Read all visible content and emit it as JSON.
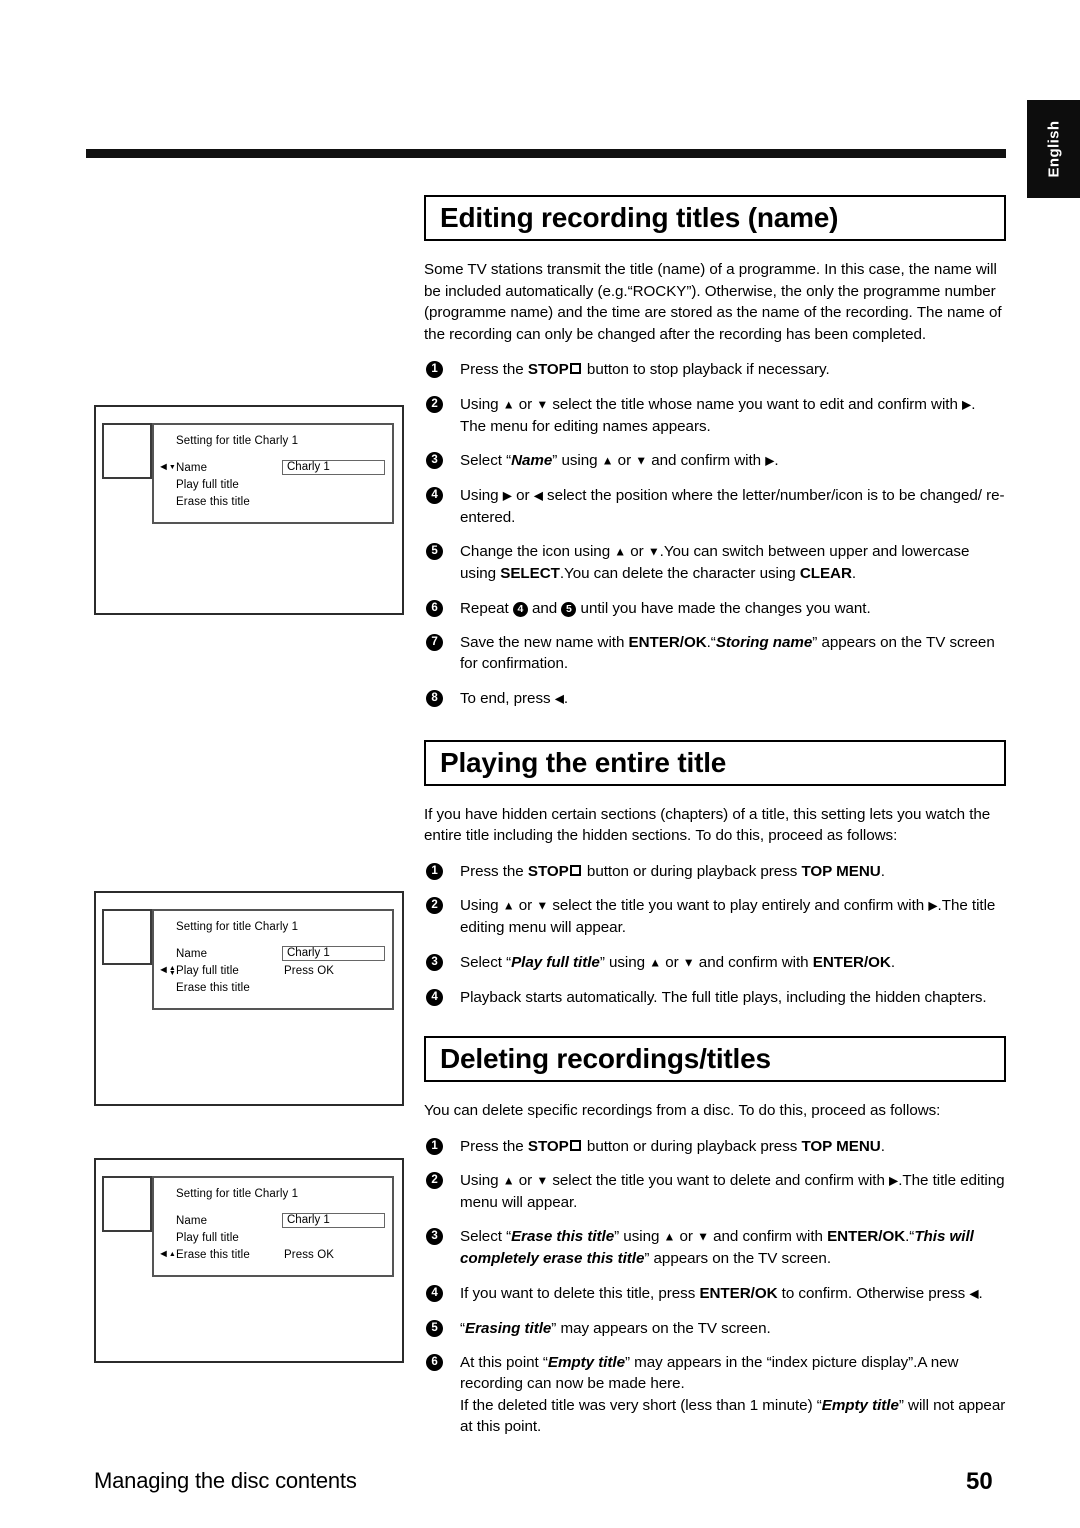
{
  "language_tab": {
    "label": "English"
  },
  "footer": {
    "section": "Managing the disc contents",
    "page": "50"
  },
  "sections": [
    {
      "id": "editing-recording-titles",
      "heading": "Editing recording titles (name)",
      "intro": "Some TV stations transmit the title (name) of a programme. In this case, the name will be included automatically (e.g. “ROCKY”). Otherwise, the only the programme number (programme name) and the time are stored as the name of the recording. The name of the recording can only be changed after the recording has been completed.",
      "steps": [
        {
          "num": "1",
          "text": "Press the STOP □ button to stop playback if necessary."
        },
        {
          "num": "2",
          "text": "Using ▲ or ▼ select the title whose name you want to edit and confirm with ▶. The menu for editing names appears."
        },
        {
          "num": "3",
          "text": "Select “Name” using ▲ or ▼ and confirm with ▶."
        },
        {
          "num": "4",
          "text": "Using ▶ or ◀ select the position where the letter/number/icon is to be changed/ re-entered."
        },
        {
          "num": "5",
          "text": "Change the icon using ▲ or ▼. You can switch between upper and lowercase using SELECT. You can delete the character using CLEAR."
        },
        {
          "num": "6",
          "text": "Repeat 4 and 5 until you have made the changes you want."
        },
        {
          "num": "7",
          "text": "Save the new name with ENTER/OK. “Storing name” appears on the TV screen for confirmation."
        },
        {
          "num": "8",
          "text": "To end, press ◀."
        }
      ]
    },
    {
      "id": "playing-the-entire-title",
      "heading": "Playing the entire title",
      "intro": "If you have hidden certain sections (chapters) of a title, this setting lets you watch the entire title including the hidden sections. To do this, proceed as follows:",
      "steps": [
        {
          "num": "1",
          "text": "Press the STOP □ button or during playback press TOP MENU."
        },
        {
          "num": "2",
          "text": "Using ▲ or ▼ select the title you want to play entirely and confirm with ▶. The title editing menu will appear."
        },
        {
          "num": "3",
          "text": "Select “Play full title” using ▲ or ▼ and confirm with ENTER/OK."
        },
        {
          "num": "4",
          "text": "Playback starts automatically. The full title plays, including the hidden chapters."
        }
      ]
    },
    {
      "id": "deleting-recordings-titles",
      "heading": "Deleting recordings/titles",
      "intro": "You can delete specific recordings from a disc. To do this, proceed as follows:",
      "steps": [
        {
          "num": "1",
          "text": "Press the STOP □ button or during playback press TOP MENU."
        },
        {
          "num": "2",
          "text": "Using ▲ or ▼ select the title you want to delete and confirm with ▶. The title editing menu will appear."
        },
        {
          "num": "3",
          "text": "Select “Erase this title” using ▲ or ▼ and confirm with ENTER/OK. “This will completely erase this title” appears on the TV screen."
        },
        {
          "num": "4",
          "text": "If you want to delete this title, press ENTER/OK to confirm. Otherwise press ◀."
        },
        {
          "num": "5",
          "text": "“Erasing title” may appears on the TV screen."
        },
        {
          "num": "6",
          "text": "At this point “Empty title” may appears in the “index picture display”. A new recording can now be made here. If the deleted title was very short (less than 1 minute) “Empty title” will not appear at this point."
        }
      ]
    }
  ],
  "diagrams": [
    {
      "id": "name-selected",
      "title": "Setting for title Charly 1",
      "rows": [
        {
          "label": "Name",
          "value_box": "Charly 1",
          "value_plain": "",
          "cursor": "left-down"
        },
        {
          "label": "Play full title",
          "value_box": "",
          "value_plain": "",
          "cursor": "none"
        },
        {
          "label": "Erase this title",
          "value_box": "",
          "value_plain": "",
          "cursor": "none"
        }
      ]
    },
    {
      "id": "play-full-title-selected",
      "title": "Setting for title Charly 1",
      "rows": [
        {
          "label": "Name",
          "value_box": "Charly 1",
          "value_plain": "",
          "cursor": "none"
        },
        {
          "label": "Play full title",
          "value_box": "",
          "value_plain": "Press OK",
          "cursor": "left-updown"
        },
        {
          "label": "Erase this title",
          "value_box": "",
          "value_plain": "",
          "cursor": "none"
        }
      ]
    },
    {
      "id": "erase-this-title-selected",
      "title": "Setting for title Charly 1",
      "rows": [
        {
          "label": "Name",
          "value_box": "Charly 1",
          "value_plain": "",
          "cursor": "none"
        },
        {
          "label": "Play full title",
          "value_box": "",
          "value_plain": "",
          "cursor": "none"
        },
        {
          "label": "Erase this title",
          "value_box": "",
          "value_plain": "Press OK",
          "cursor": "left-up"
        }
      ]
    }
  ]
}
